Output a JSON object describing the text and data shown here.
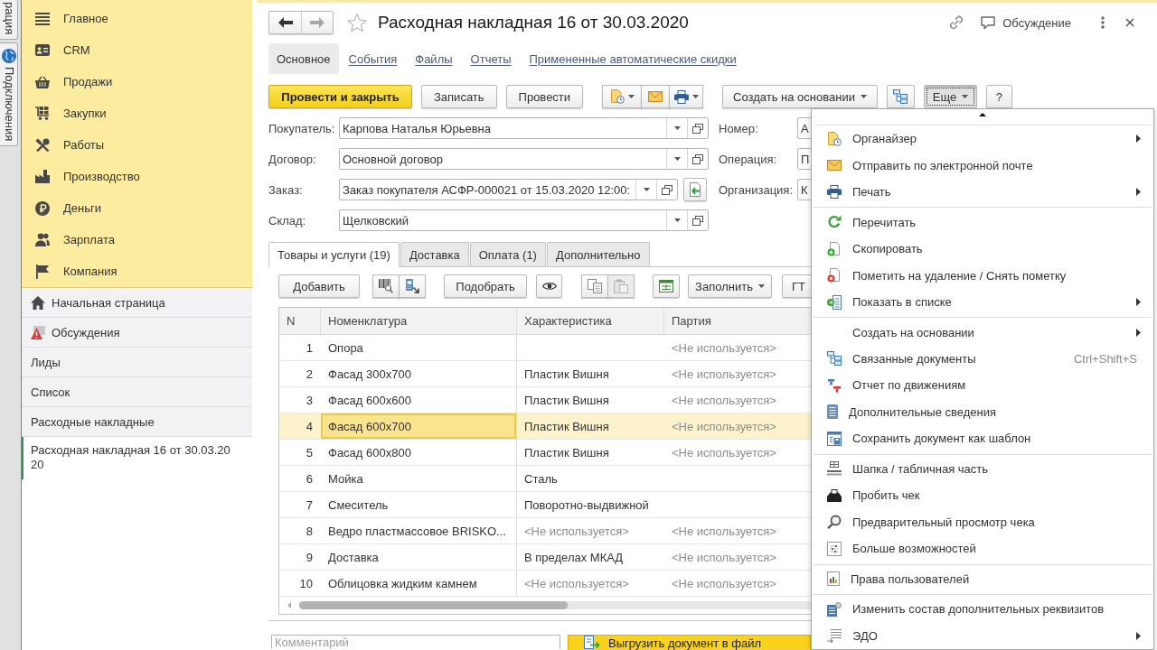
{
  "side_tabs": [
    {
      "label": "рация"
    },
    {
      "label": "Подключения"
    }
  ],
  "sections": [
    {
      "label": "Главное"
    },
    {
      "label": "CRM"
    },
    {
      "label": "Продажи"
    },
    {
      "label": "Закупки"
    },
    {
      "label": "Работы"
    },
    {
      "label": "Производство"
    },
    {
      "label": "Деньги"
    },
    {
      "label": "Зарплата"
    },
    {
      "label": "Компания"
    }
  ],
  "open_windows": [
    {
      "label": "Начальная страница",
      "selected": false
    },
    {
      "label": "Обсуждения",
      "selected": false
    },
    {
      "label": "Лиды",
      "selected": false
    },
    {
      "label": "Список",
      "selected": false
    },
    {
      "label": "Расходные накладные",
      "selected": false
    },
    {
      "label": "Расходная накладная 16 от 30.03.2020",
      "selected": true
    }
  ],
  "window": {
    "title": "Расходная накладная 16 от 30.03.2020",
    "favorite": false,
    "back_disabled": false,
    "forward_disabled": true,
    "discussion": "Обсуждение"
  },
  "form_tabs": [
    {
      "label": "Основное",
      "selected": true
    },
    {
      "label": "События",
      "selected": false
    },
    {
      "label": "Файлы",
      "selected": false
    },
    {
      "label": "Отчеты",
      "selected": false
    },
    {
      "label": "Примененные автоматические скидки",
      "selected": false
    }
  ],
  "command_bar": {
    "buttons": [
      {
        "label": "Провести и закрыть",
        "kind": "primary"
      },
      {
        "label": "Записать",
        "kind": "plain"
      },
      {
        "label": "Провести",
        "kind": "plain"
      }
    ],
    "create_based_on": "Создать на основании",
    "more": {
      "label": "Еще",
      "pressed": true
    },
    "help": "?"
  },
  "fields": [
    {
      "label": "Покупатель:",
      "value": "Карпова Наталья Юрьевна",
      "has_action": false
    },
    {
      "label": "Договор:",
      "value": "Основной договор",
      "has_action": false
    },
    {
      "label": "Заказ:",
      "value": "Заказ покупателя АСФР-000021 от 15.03.2020 12:00:",
      "has_action": true
    },
    {
      "label": "Склад:",
      "value": "Щелковский",
      "has_action": false
    }
  ],
  "right_fields": [
    {
      "label": "Номер:",
      "value": "А"
    },
    {
      "label": "Операция:",
      "value": "П"
    },
    {
      "label": "Организация:",
      "value": "К"
    }
  ],
  "table_tabs": [
    {
      "label": "Товары и услуги (19)",
      "selected": true
    },
    {
      "label": "Доставка",
      "selected": false
    },
    {
      "label": "Оплата (1)",
      "selected": false
    },
    {
      "label": "Дополнительно",
      "selected": false
    }
  ],
  "table_toolbar": {
    "add": "Добавить",
    "pick": "Подобрать",
    "paste_disabled": true,
    "fill": "Заполнить",
    "next": "ГТ"
  },
  "table": {
    "columns": [
      "N",
      "Номенклатура",
      "Характеристика",
      "Партия"
    ],
    "rows": [
      {
        "n": "1",
        "nomenclature": "Опора",
        "batch": "<Не используется>",
        "batch_muted": true,
        "selected": false
      },
      {
        "n": "2",
        "nomenclature": "Фасад 300x700",
        "characteristic": "Пластик Вишня",
        "characteristic_muted": false,
        "batch": "<Не используется>",
        "batch_muted": true,
        "selected": false
      },
      {
        "n": "3",
        "nomenclature": "Фасад 600x600",
        "characteristic": "Пластик Вишня",
        "characteristic_muted": false,
        "batch": "<Не используется>",
        "batch_muted": true,
        "selected": false
      },
      {
        "n": "4",
        "nomenclature": "Фасад 600x700",
        "characteristic": "Пластик Вишня",
        "characteristic_muted": false,
        "batch": "<Не используется>",
        "batch_muted": true,
        "selected": true
      },
      {
        "n": "5",
        "nomenclature": "Фасад 600x800",
        "characteristic": "Пластик Вишня",
        "characteristic_muted": false,
        "batch": "<Не используется>",
        "batch_muted": true,
        "selected": false
      },
      {
        "n": "6",
        "nomenclature": "Мойка",
        "characteristic": "Сталь",
        "characteristic_muted": false,
        "selected": false
      },
      {
        "n": "7",
        "nomenclature": "Смеситель",
        "characteristic": "Поворотно-выдвижной",
        "characteristic_muted": false,
        "selected": false
      },
      {
        "n": "8",
        "nomenclature": "Ведро пластмассовое BRISKO...",
        "characteristic": "<Не используется>",
        "characteristic_muted": true,
        "batch": "<Не используется>",
        "batch_muted": true,
        "selected": false
      },
      {
        "n": "9",
        "nomenclature": "Доставка",
        "characteristic": "В пределах МКАД",
        "characteristic_muted": false,
        "batch": "<Не используется>",
        "batch_muted": true,
        "selected": false
      },
      {
        "n": "10",
        "nomenclature": "Облицовка жидким камнем",
        "characteristic": "<Не используется>",
        "characteristic_muted": true,
        "batch": "<Не используется>",
        "batch_muted": true,
        "selected": false
      }
    ]
  },
  "comment": {
    "placeholder": "Комментарий"
  },
  "notification": {
    "text": "Выгрузить документ в файл"
  },
  "menu": {
    "groups": [
      [
        {
          "label": "Органайзер",
          "submenu": true
        },
        {
          "label": "Отправить по электронной почте",
          "submenu": false
        },
        {
          "label": "Печать",
          "submenu": true
        }
      ],
      [
        {
          "label": "Перечитать",
          "submenu": false
        },
        {
          "label": "Скопировать",
          "submenu": false
        },
        {
          "label": "Пометить на удаление / Снять пометку",
          "submenu": false
        },
        {
          "label": "Показать в списке",
          "submenu": true
        }
      ],
      [
        {
          "label": "Создать на основании",
          "submenu": true
        },
        {
          "label": "Связанные документы",
          "shortcut": "Ctrl+Shift+S",
          "submenu": false
        },
        {
          "label": "Отчет по движениям",
          "submenu": false
        },
        {
          "label": "Дополнительные сведения",
          "submenu": false
        },
        {
          "label": "Сохранить документ как шаблон",
          "submenu": false
        }
      ],
      [
        {
          "label": "Шапка / табличная часть",
          "submenu": false
        },
        {
          "label": "Пробить чек",
          "submenu": false
        },
        {
          "label": "Предварительный просмотр чека",
          "submenu": false
        },
        {
          "label": "Больше возможностей",
          "submenu": false
        }
      ],
      [
        {
          "label": "Права пользователей",
          "submenu": false
        }
      ],
      [
        {
          "label": "Изменить состав дополнительных реквизитов",
          "submenu": false
        },
        {
          "label": "ЭДО",
          "submenu": true
        }
      ]
    ]
  }
}
